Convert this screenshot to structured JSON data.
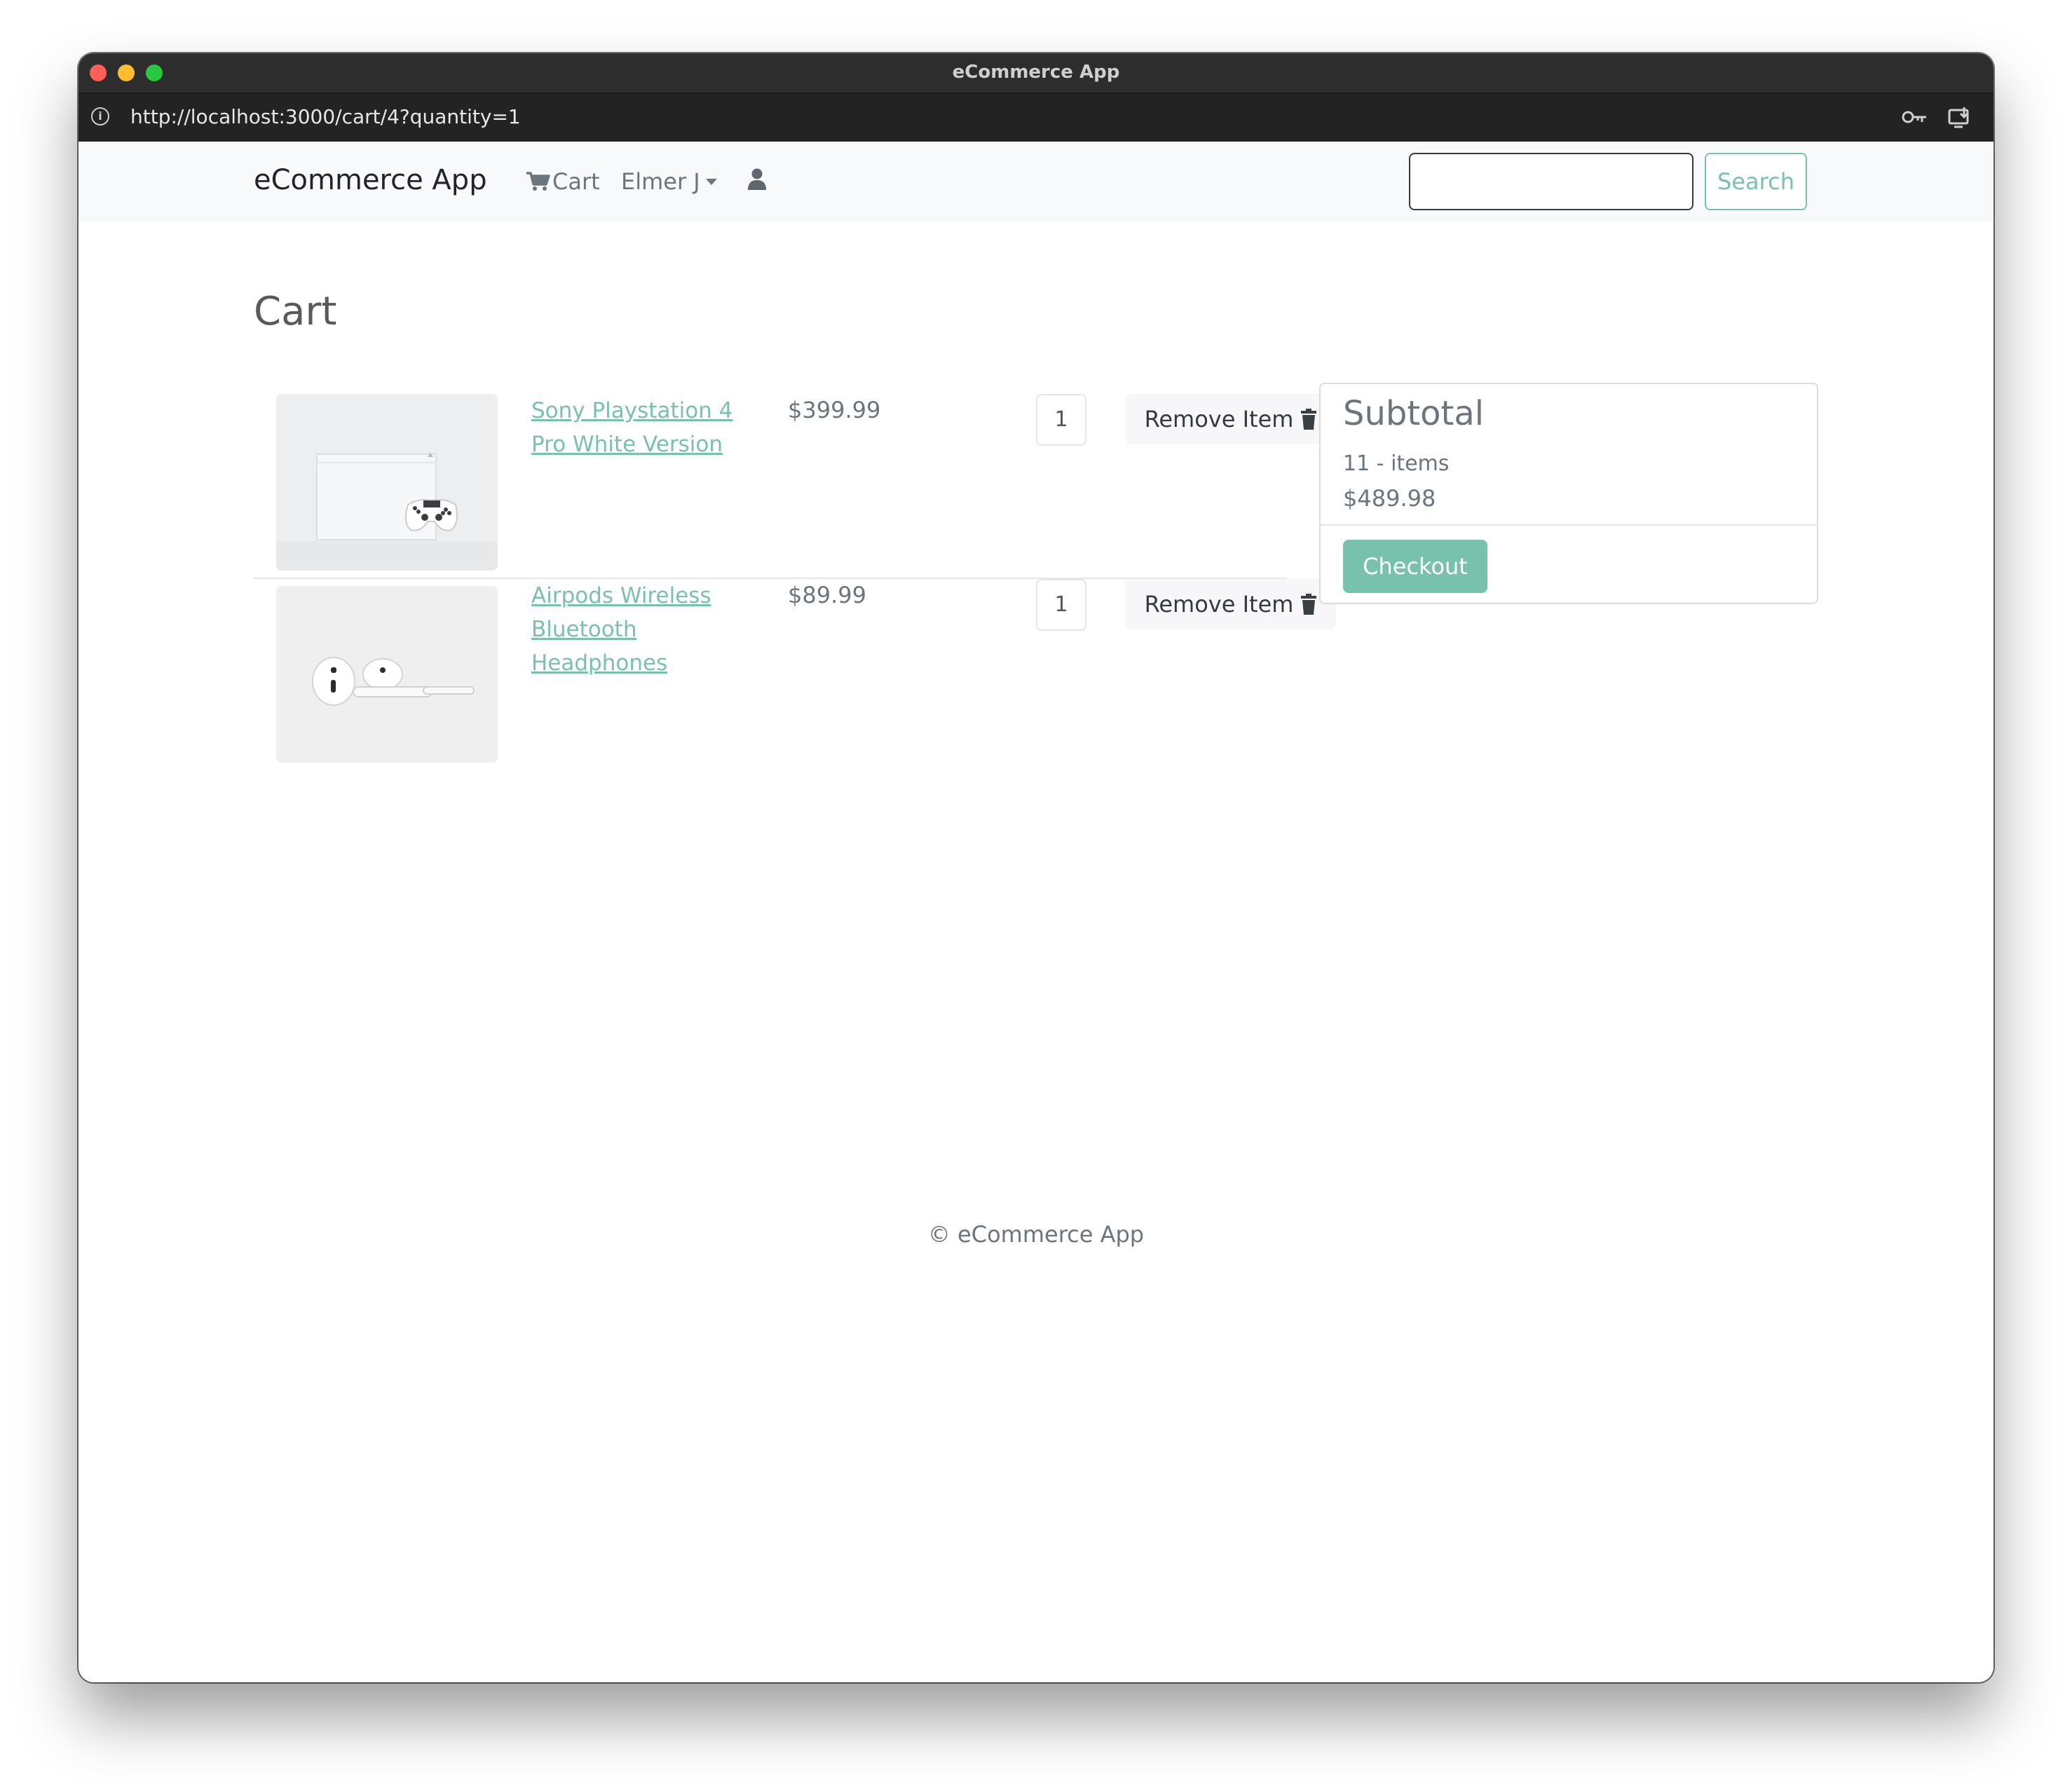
{
  "window": {
    "title": "eCommerce App"
  },
  "browser": {
    "url": "http://localhost:3000/cart/4?quantity=1"
  },
  "navbar": {
    "brand": "eCommerce App",
    "cart_label": "Cart",
    "user_label": "Elmer J",
    "search_placeholder": "",
    "search_button": "Search"
  },
  "cart": {
    "title": "Cart",
    "items": [
      {
        "name": "Sony Playstation 4 Pro White Version",
        "price": "$399.99",
        "quantity": "1",
        "remove_label": "Remove Item"
      },
      {
        "name": "Airpods Wireless Bluetooth Headphones",
        "price": "$89.99",
        "quantity": "1",
        "remove_label": "Remove Item"
      }
    ]
  },
  "summary": {
    "title": "Subtotal",
    "items_text": "11 - items",
    "total": "$489.98",
    "checkout_label": "Checkout"
  },
  "footer": {
    "text": "© eCommerce App"
  },
  "colors": {
    "accent": "#78c2ad",
    "text_muted": "#6c757d",
    "navbar_bg": "#f8f9fa"
  }
}
